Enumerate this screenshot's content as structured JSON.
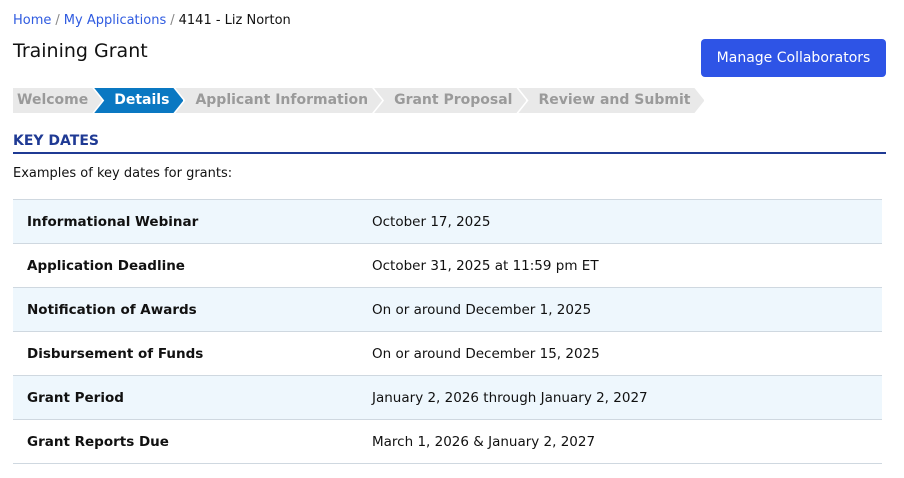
{
  "breadcrumb": {
    "home": "Home",
    "apps": "My Applications",
    "current": "4141 - Liz Norton",
    "sep": "/"
  },
  "title": "Training Grant",
  "manage_button": "Manage Collaborators",
  "steps": [
    "Welcome",
    "Details",
    "Applicant Information",
    "Grant Proposal",
    "Review and Submit"
  ],
  "section_title": "KEY DATES",
  "intro": "Examples of key dates for grants:",
  "rows": [
    {
      "label": "Informational Webinar",
      "value": "October 17, 2025"
    },
    {
      "label": "Application Deadline",
      "value": "October 31, 2025 at 11:59 pm ET"
    },
    {
      "label": "Notification of Awards",
      "value": "On or around December 1, 2025"
    },
    {
      "label": "Disbursement of Funds",
      "value": "On or around December 15, 2025"
    },
    {
      "label": "Grant Period",
      "value": "January 2, 2026 through January 2, 2027"
    },
    {
      "label": "Grant Reports Due",
      "value": "March 1, 2026 & January 2, 2027"
    }
  ]
}
